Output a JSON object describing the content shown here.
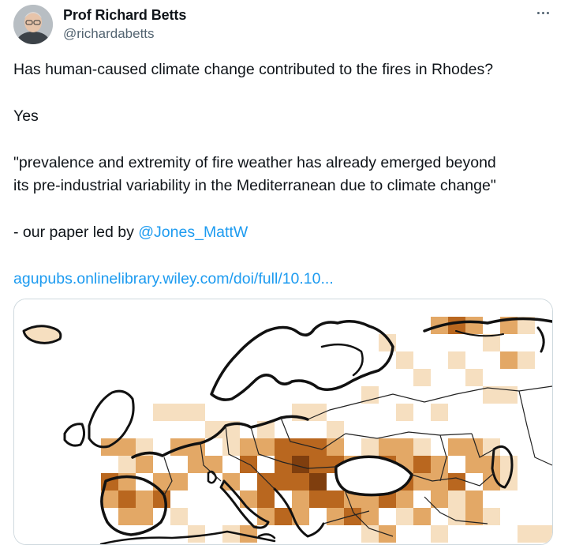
{
  "author": {
    "name": "Prof Richard Betts",
    "handle": "@richardabetts"
  },
  "tweet": {
    "line1": "Has human-caused climate change contributed to the fires in Rhodes?",
    "line2": "Yes",
    "quote_line1": "\"prevalence and extremity of fire weather has already emerged beyond",
    "quote_line2": "its pre-industrial variability in the Mediterranean due to climate change\"",
    "paper_prefix": "- our paper led by ",
    "mention": "@Jones_MattW",
    "link": "agupubs.onlinelibrary.wiley.com/doi/full/10.10..."
  },
  "media": {
    "type": "map",
    "colors": {
      "land_white": "#ffffff",
      "light": "#f6dfc0",
      "mid": "#e3a866",
      "dark": "#b9671f",
      "darkest": "#7f3e0e",
      "border": "#111111"
    }
  },
  "icons": {
    "more": "more-horizontal-icon",
    "avatar": "profile-photo"
  },
  "colors": {
    "link": "#1d9bf0",
    "secondary_text": "#536471",
    "text": "#0f1419"
  }
}
